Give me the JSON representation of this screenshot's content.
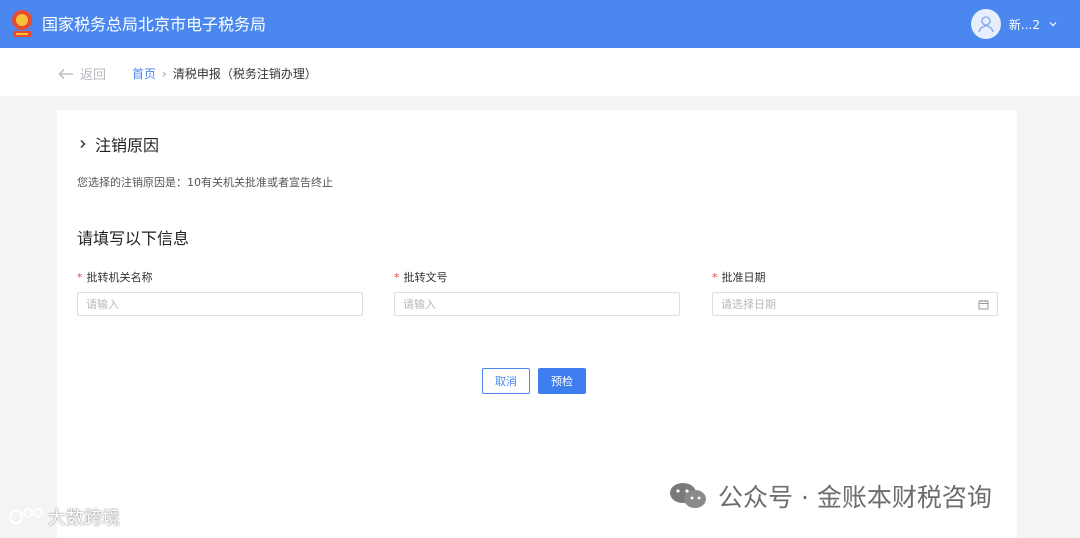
{
  "header": {
    "title": "国家税务总局北京市电子税务局",
    "user_name": "新...2"
  },
  "nav": {
    "back_label": "返回",
    "breadcrumb_home": "首页",
    "breadcrumb_current": "清税申报（税务注销办理）"
  },
  "section": {
    "title": "注销原因",
    "reason_prefix": "您选择的注销原因是：",
    "reason_value": "10有关机关批准或者宣告终止"
  },
  "form": {
    "title": "请填写以下信息",
    "fields": [
      {
        "label": "批转机关名称",
        "placeholder": "请输入"
      },
      {
        "label": "批转文号",
        "placeholder": "请输入"
      },
      {
        "label": "批准日期",
        "placeholder": "请选择日期"
      }
    ],
    "required_mark": "*"
  },
  "buttons": {
    "cancel": "取消",
    "precheck": "预检"
  },
  "watermarks": {
    "left": "大数跨境",
    "right": "公众号 · 金账本财税咨询"
  },
  "colors": {
    "header_bg": "#4a88f0",
    "primary": "#3f7ef0",
    "required": "#e54848"
  }
}
